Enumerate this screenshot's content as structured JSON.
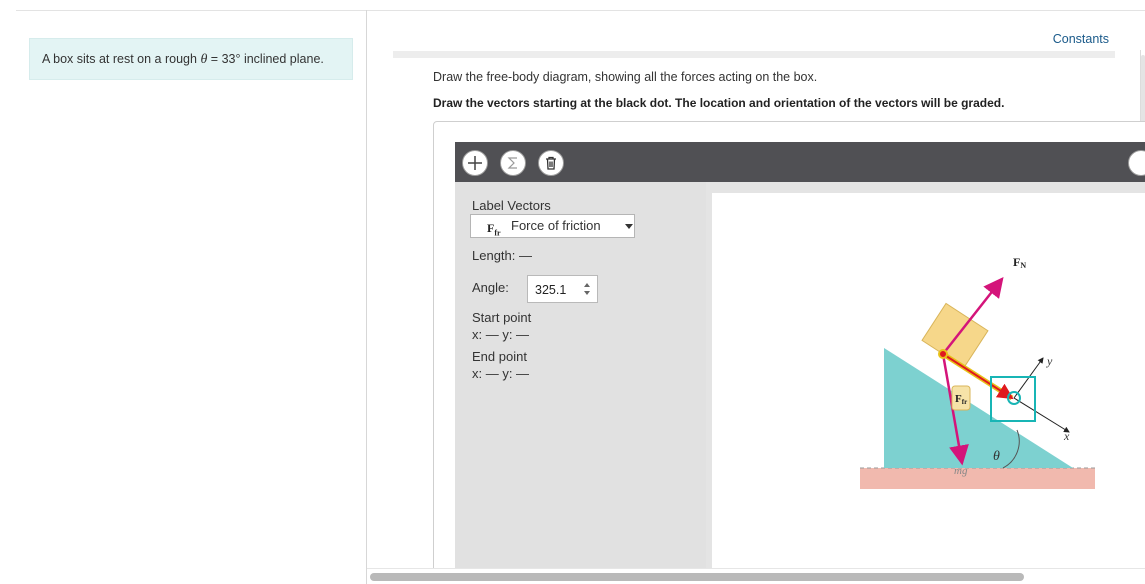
{
  "problem": {
    "prefix": "A box sits at rest on a rough ",
    "theta": "θ",
    "relation": " = 33° inclined plane."
  },
  "header": {
    "constants_link": "Constants"
  },
  "instructions": {
    "line1": "Draw the free-body diagram, showing all the forces acting on the box.",
    "line2": "Draw the vectors starting at the black dot. The location and orientation of the vectors will be graded."
  },
  "toolbar": {
    "add_icon": "plus-icon",
    "sum_icon": "sigma-icon",
    "delete_icon": "trash-icon"
  },
  "panel": {
    "label_vectors": "Label Vectors",
    "selected_vector_symbol": "F",
    "selected_vector_subscript": "fr",
    "selected_vector_name": "Force of friction",
    "length_label": "Length:",
    "length_value": "—",
    "angle_label": "Angle:",
    "angle_value": "325.1",
    "start_point_label": "Start point",
    "start_point_xy": "x: — y: —",
    "end_point_label": "End point",
    "end_point_xy": "x: — y: —"
  },
  "diagram": {
    "normal_force_label": "F",
    "normal_force_subscript": "N",
    "friction_label": "F",
    "friction_subscript": "fr",
    "weight_label": "mg",
    "angle_label": "θ",
    "x_axis_label": "x",
    "y_axis_label": "y",
    "colors": {
      "incline": "#7dd1d0",
      "ground": "#f1b9ae",
      "box": "#f6d78a",
      "vector": "#d4147a",
      "active_vector": "#e8c21a",
      "selection": "#18b5b5"
    }
  }
}
